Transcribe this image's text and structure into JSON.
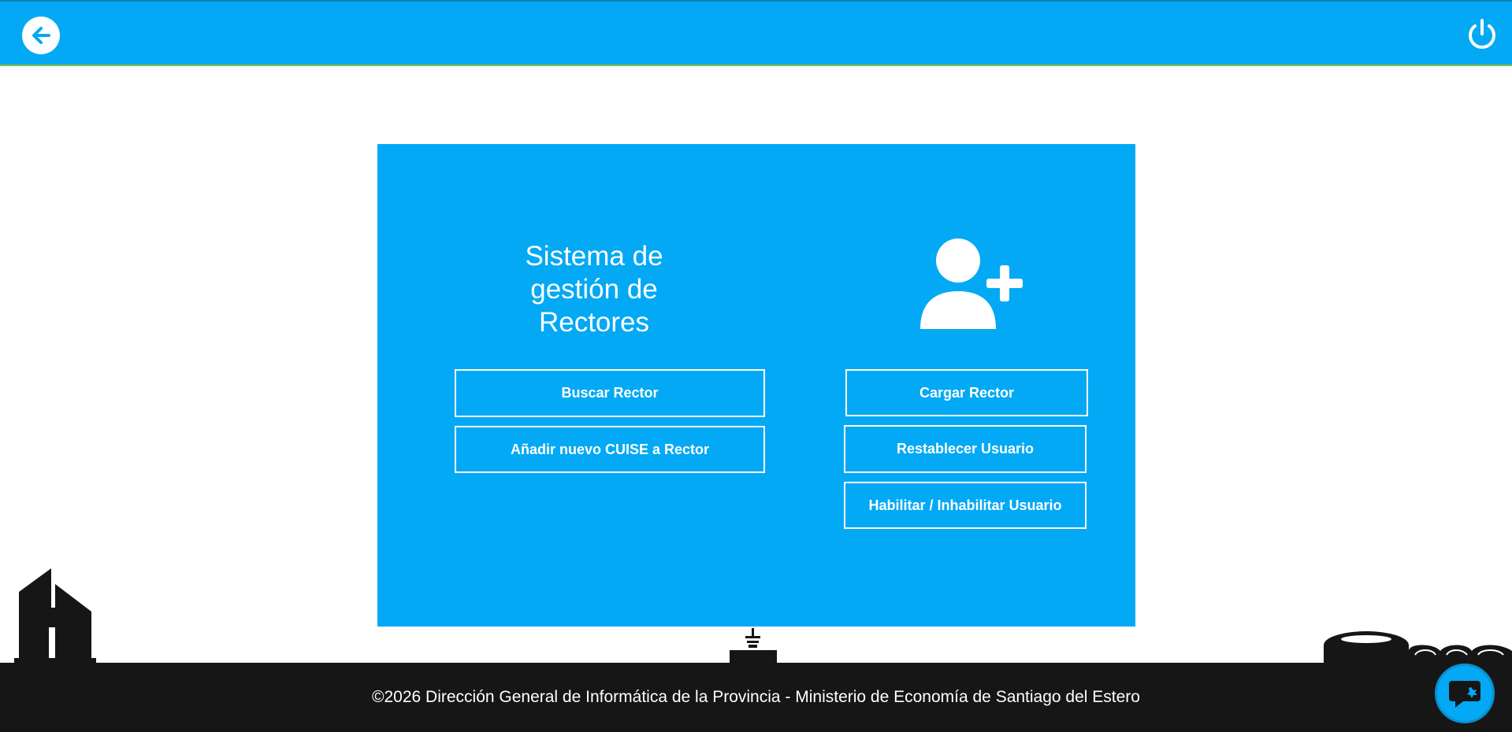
{
  "header": {
    "back_icon": "arrow-left-icon",
    "power_icon": "power-icon",
    "brand_color": "#03a9f4"
  },
  "card": {
    "title_line1": "Sistema de",
    "title_line2": "gestión de Rectores",
    "illustration_icon": "user-plus-icon",
    "buttons": {
      "buscar": "Buscar Rector",
      "anadir_cuise": "Añadir nuevo CUISE a Rector",
      "cargar": "Cargar Rector",
      "restablecer": "Restablecer Usuario",
      "habilitar": "Habilitar / Inhabilitar Usuario"
    }
  },
  "footer": {
    "text": "©2026 Dirección General de Informática de la Provincia - Ministerio de Economía de Santiago del Estero",
    "background_color": "#161616"
  },
  "chat": {
    "icon": "chat-bubble-icon"
  }
}
